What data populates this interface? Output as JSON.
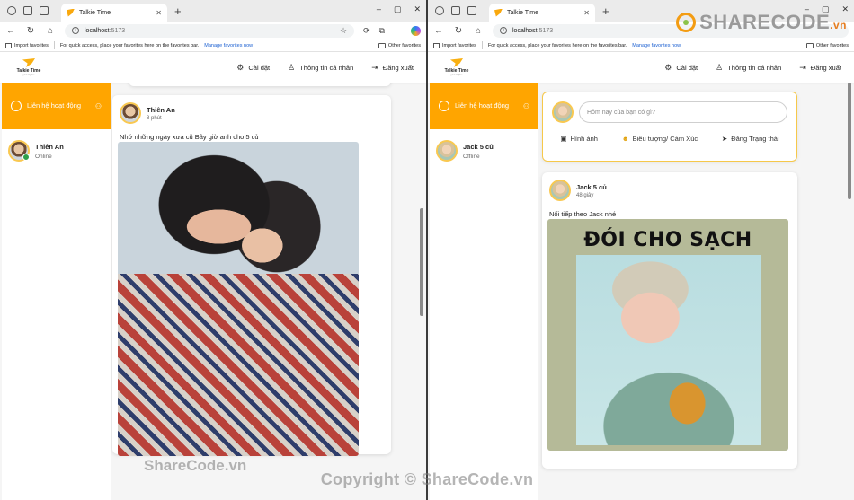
{
  "browser": {
    "tab_title": "Talkie Time",
    "tab_close": "✕",
    "new_tab": "+",
    "url_host": "localhost",
    "url_port": ":5173",
    "fav_import": "Import favorites",
    "fav_hint": "For quick access, place your favorites here on the favorites bar.",
    "fav_manage": "Manage favorites now",
    "fav_other": "Other favorites",
    "win_controls": [
      "–",
      "▢",
      "✕"
    ]
  },
  "app": {
    "logo_text": "Talkie Time",
    "logo_sub": "your tagline",
    "nav": [
      {
        "label": "Cài đặt",
        "icon": "gear-icon"
      },
      {
        "label": "Thông tin cá nhân",
        "icon": "user-icon"
      },
      {
        "label": "Đăng xuất",
        "icon": "logout-icon"
      }
    ],
    "sidebar_title": "Liên hệ hoạt động"
  },
  "left": {
    "contact": {
      "name": "Thiên An",
      "status": "Online"
    },
    "post": {
      "author": "Thiên An",
      "time": "8 phút",
      "text": "Nhớ những ngày xưa cũ Bây giờ anh cho 5 củ"
    }
  },
  "right": {
    "contact": {
      "name": "Jack 5 củ",
      "status": "Offline"
    },
    "composer": {
      "placeholder": "Hôm nay của bạn có gì?",
      "actions": [
        "Hình ảnh",
        "Biểu tượng/ Cảm Xúc",
        "Đăng Trạng thái"
      ]
    },
    "post": {
      "author": "Jack 5 củ",
      "time": "48 giây",
      "text": "Nối tiếp theo Jack nhé",
      "image_caption": "ĐÓI CHO SẠCH"
    }
  },
  "watermark": {
    "left": "ShareCode.vn",
    "center": "Copyright © ShareCode.vn",
    "brand": "SHARECODE",
    "brand_domain": ".vn"
  },
  "colors": {
    "accent": "#ffa500",
    "online": "#2fa04a",
    "link": "#1a5fd1"
  }
}
